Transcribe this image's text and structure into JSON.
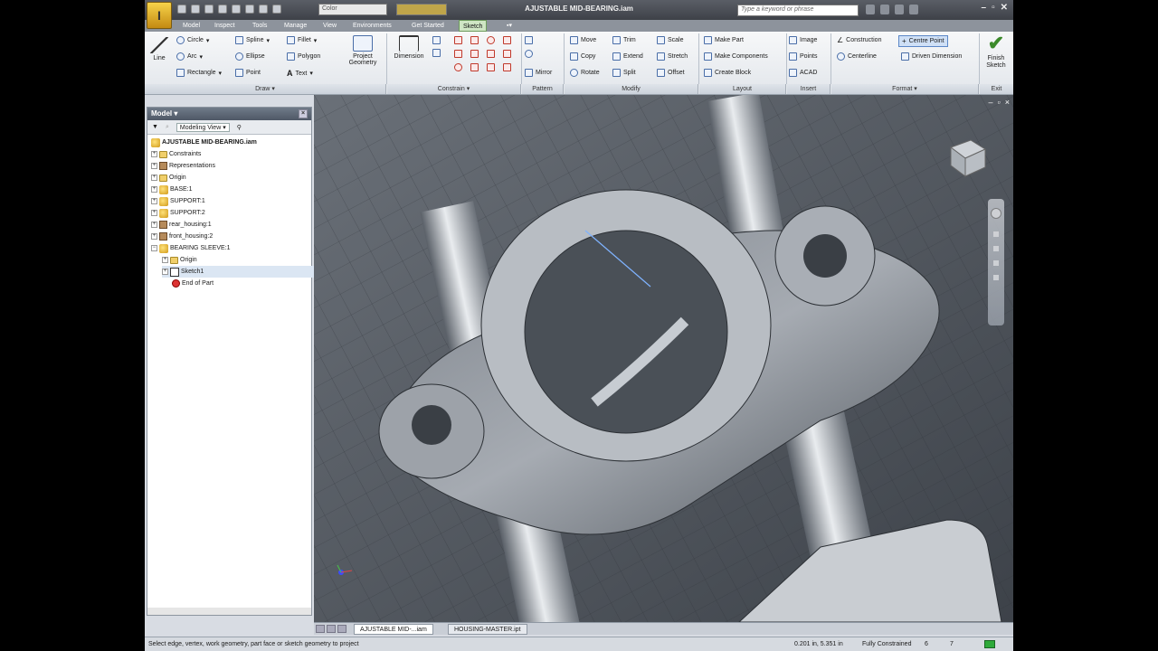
{
  "window": {
    "title": "AJUSTABLE MID-BEARING.iam",
    "search_placeholder": "Type a keyword or phrase",
    "material_combo": "Color"
  },
  "tabs": [
    {
      "label": "Model"
    },
    {
      "label": "Inspect"
    },
    {
      "label": "Tools"
    },
    {
      "label": "Manage"
    },
    {
      "label": "View"
    },
    {
      "label": "Environments"
    },
    {
      "label": "Get Started"
    },
    {
      "label": "Sketch"
    }
  ],
  "ribbon": {
    "draw": {
      "line": "Line",
      "circle": "Circle",
      "arc": "Arc",
      "rectangle": "Rectangle",
      "spline": "Spline",
      "ellipse": "Ellipse",
      "point": "Point",
      "fillet": "Fillet",
      "polygon": "Polygon",
      "text": "Text",
      "project_geometry": "Project Geometry",
      "panel": "Draw"
    },
    "constrain": {
      "dimension": "Dimension",
      "panel": "Constrain"
    },
    "pattern": {
      "mirror": "Mirror",
      "panel": "Pattern"
    },
    "modify": {
      "move": "Move",
      "copy": "Copy",
      "rotate": "Rotate",
      "trim": "Trim",
      "extend": "Extend",
      "split": "Split",
      "scale": "Scale",
      "stretch": "Stretch",
      "offset": "Offset",
      "panel": "Modify"
    },
    "layout": {
      "make_part": "Make Part",
      "make_components": "Make Components",
      "create_block": "Create Block",
      "panel": "Layout"
    },
    "insert": {
      "image": "Image",
      "points": "Points",
      "acad": "ACAD",
      "panel": "Insert"
    },
    "format": {
      "construction": "Construction",
      "centre_point": "Centre Point",
      "centerline": "Centerline",
      "driven_dimension": "Driven Dimension",
      "panel": "Format"
    },
    "exit": {
      "finish_sketch": "Finish Sketch",
      "panel": "Exit"
    }
  },
  "browser": {
    "title": "Model",
    "view_selector": "Modeling View",
    "items": [
      {
        "label": "AJUSTABLE MID-BEARING.iam"
      },
      {
        "label": "Constraints"
      },
      {
        "label": "Representations"
      },
      {
        "label": "Origin"
      },
      {
        "label": "BASE:1"
      },
      {
        "label": "SUPPORT:1"
      },
      {
        "label": "SUPPORT:2"
      },
      {
        "label": "rear_housing:1"
      },
      {
        "label": "front_housing:2"
      },
      {
        "label": "BEARING SLEEVE:1"
      },
      {
        "label": "Origin"
      },
      {
        "label": "Sketch1"
      },
      {
        "label": "End of Part"
      }
    ]
  },
  "doc_tabs": [
    {
      "label": "AJUSTABLE MID-...iam"
    },
    {
      "label": "HOUSING-MASTER.ipt"
    }
  ],
  "status": {
    "prompt": "Select edge, vertex, work geometry, part face or sketch geometry to project",
    "coords": "0.201 in, 5.351 in",
    "constraint": "Fully Constrained",
    "count1": "6",
    "count2": "7"
  },
  "colors": {
    "accent_tab": "#cfe6c4",
    "model_shade": "#8c929b",
    "finish_check": "#3b8a2a",
    "status_ok": "#2faa3a"
  }
}
